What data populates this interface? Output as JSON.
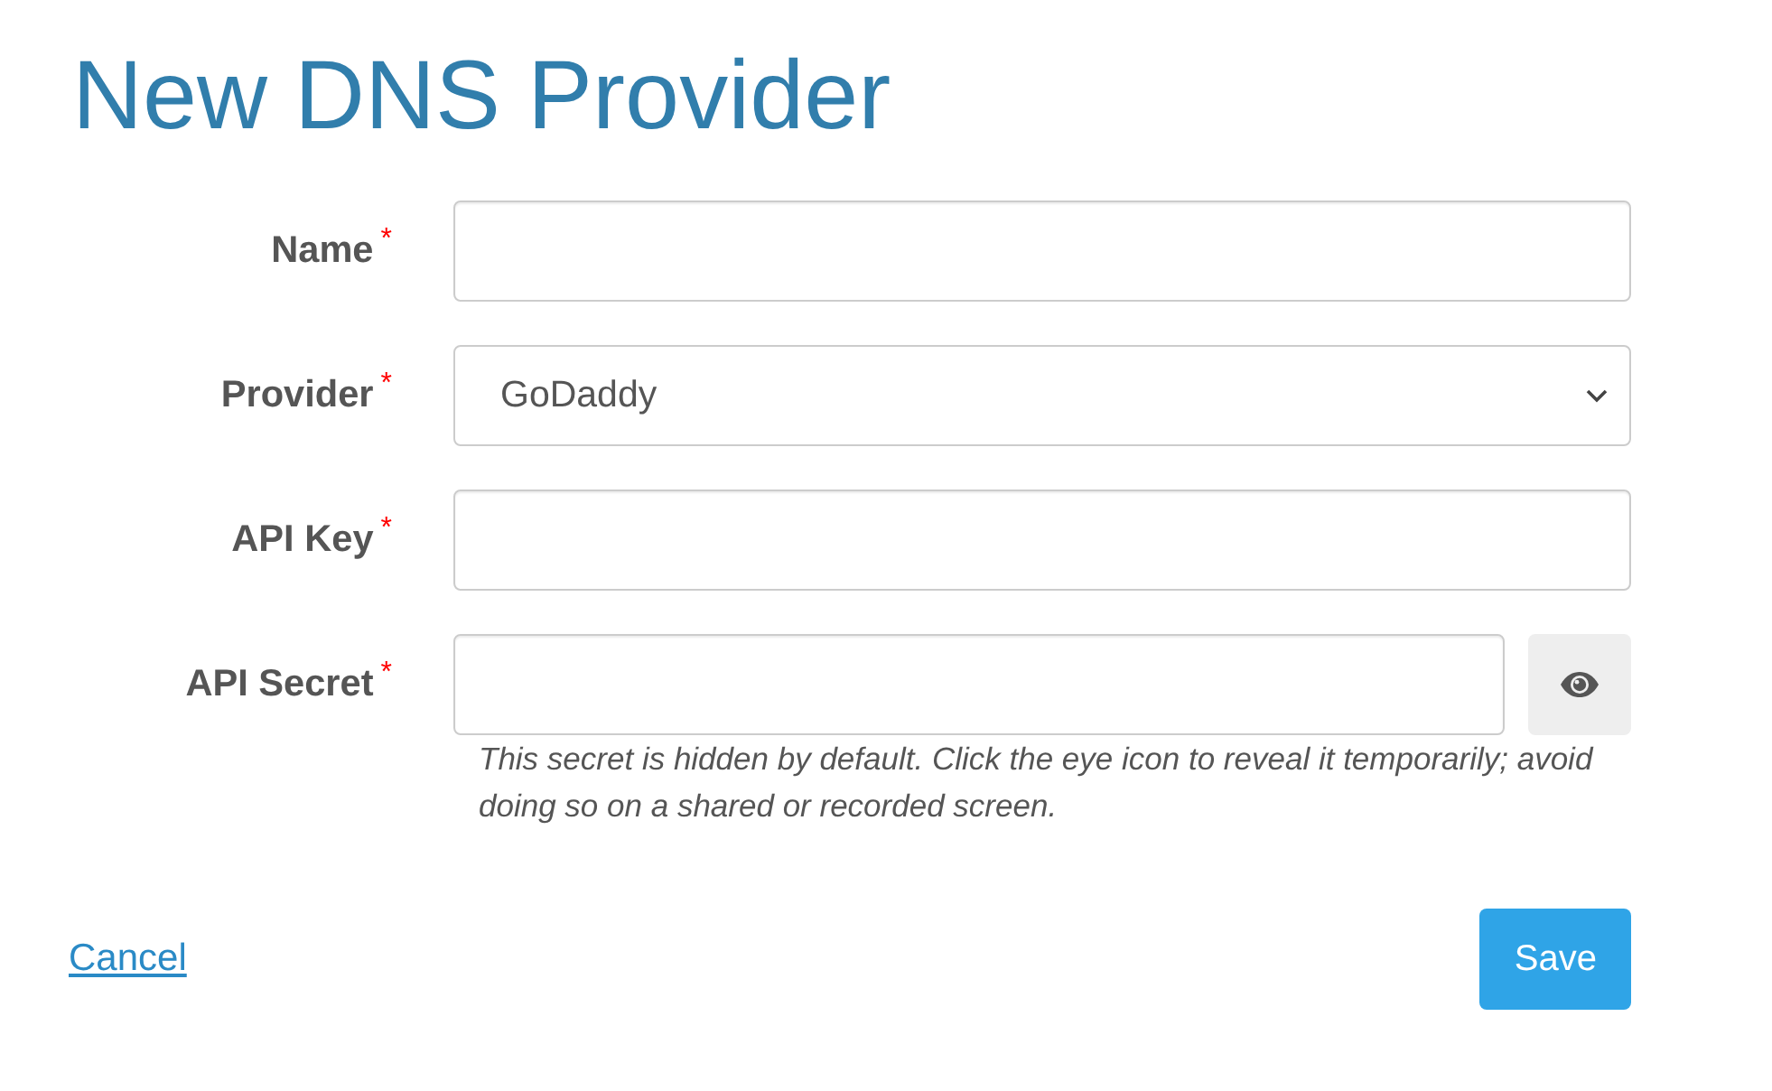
{
  "page": {
    "title": "New DNS Provider"
  },
  "fields": [
    {
      "kind": "text",
      "label": "Name",
      "marker": "*"
    },
    {
      "kind": "select",
      "label": "Provider",
      "marker": "*",
      "value": "GoDaddy"
    },
    {
      "kind": "text",
      "label": "API Key",
      "marker": "*"
    },
    {
      "kind": "secret",
      "label": "API Secret",
      "marker": "*",
      "help": "This secret is hidden by default. Click the eye icon to reveal it temporarily; avoid doing so on a shared or recorded screen."
    }
  ],
  "actions": {
    "cancel": "Cancel",
    "save": "Save"
  }
}
